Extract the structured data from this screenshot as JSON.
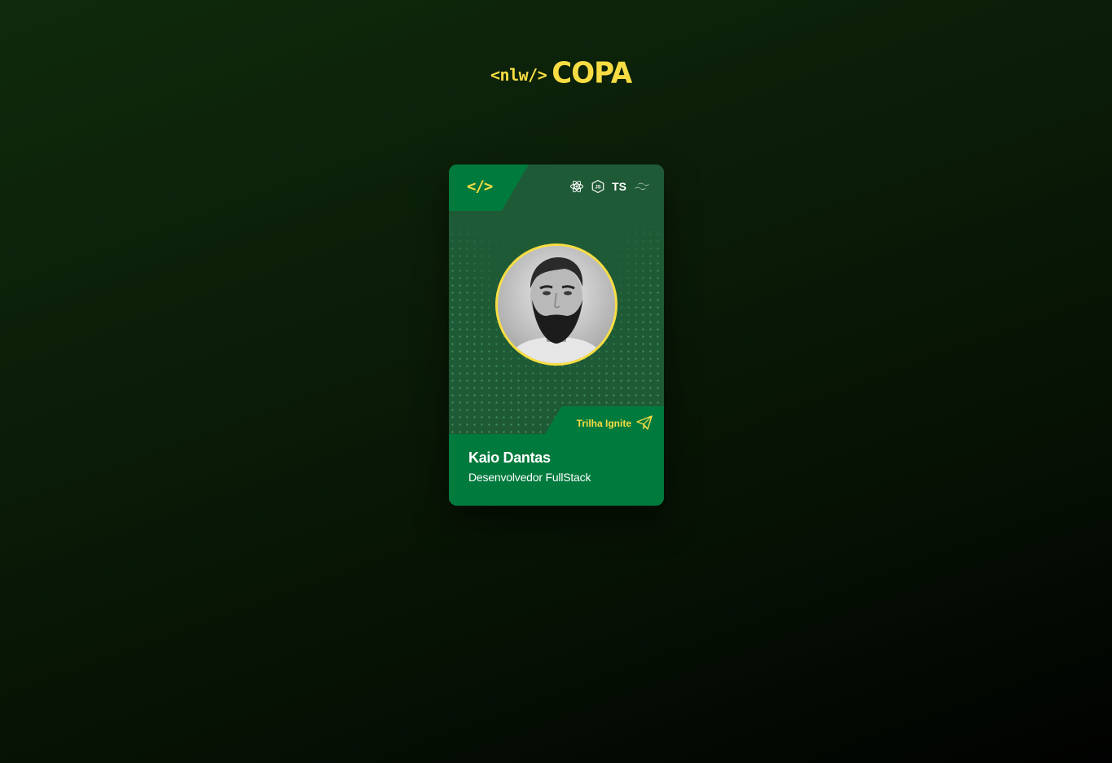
{
  "header": {
    "logo_prefix": "<nlw/>",
    "logo_main": "COPA"
  },
  "card": {
    "code_icon": "</>",
    "tech_icons": [
      "react-icon",
      "nodejs-icon",
      "typescript-icon",
      "tailwind-icon"
    ],
    "ts_label": "TS",
    "trail_label": "Trilha Ignite",
    "trail_icon": "paper-plane-icon",
    "name": "Kaio Dantas",
    "role": "Desenvolvedor FullStack"
  },
  "colors": {
    "accent_yellow": "#f7dd43",
    "card_green": "#007a3d",
    "card_dark_green": "#1f5a36",
    "background_dark": "#0b1e08"
  }
}
